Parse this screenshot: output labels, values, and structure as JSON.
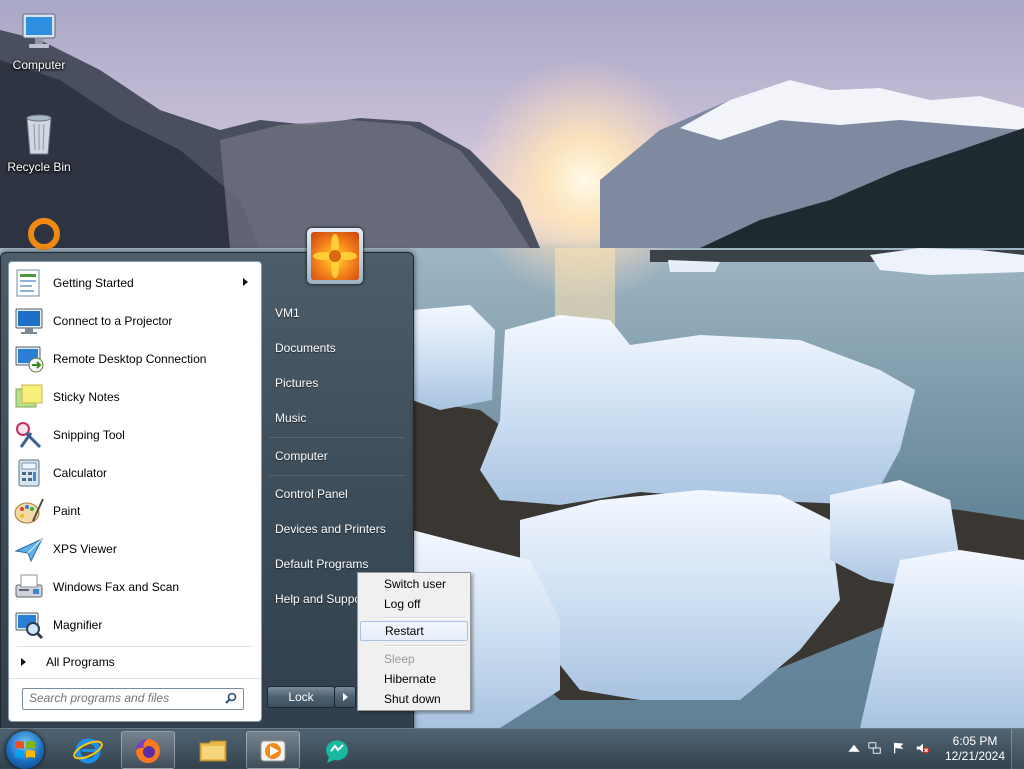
{
  "desktop": {
    "icons": [
      {
        "label": "Computer",
        "icon": "computer-icon"
      },
      {
        "label": "Recycle Bin",
        "icon": "recycle-bin-icon"
      }
    ]
  },
  "start_menu": {
    "programs": [
      {
        "label": "Getting Started",
        "icon": "getting-started-icon",
        "has_submenu": true
      },
      {
        "label": "Connect to a Projector",
        "icon": "projector-icon"
      },
      {
        "label": "Remote Desktop Connection",
        "icon": "remote-desktop-icon"
      },
      {
        "label": "Sticky Notes",
        "icon": "sticky-notes-icon"
      },
      {
        "label": "Snipping Tool",
        "icon": "scissors-icon"
      },
      {
        "label": "Calculator",
        "icon": "calculator-icon"
      },
      {
        "label": "Paint",
        "icon": "paint-palette-icon"
      },
      {
        "label": "XPS Viewer",
        "icon": "xps-viewer-icon"
      },
      {
        "label": "Windows Fax and Scan",
        "icon": "fax-icon"
      },
      {
        "label": "Magnifier",
        "icon": "magnifier-icon"
      }
    ],
    "all_programs": "All Programs",
    "search_placeholder": "Search programs and files",
    "right_items": [
      "VM1",
      "Documents",
      "Pictures",
      "Music",
      "Computer",
      "Control Panel",
      "Devices and Printers",
      "Default Programs",
      "Help and Support"
    ],
    "shutdown_button": "Lock"
  },
  "power_menu": {
    "items": [
      {
        "label": "Switch user",
        "enabled": true
      },
      {
        "label": "Log off",
        "enabled": true
      },
      {
        "label": "Restart",
        "enabled": true,
        "highlighted": true
      },
      {
        "label": "Sleep",
        "enabled": false
      },
      {
        "label": "Hibernate",
        "enabled": true
      },
      {
        "label": "Shut down",
        "enabled": true
      }
    ]
  },
  "taskbar": {
    "pinned": [
      "internet-explorer-icon",
      "firefox-icon",
      "file-explorer-icon",
      "media-player-icon",
      "messenger-icon"
    ],
    "clock": {
      "time": "6:05 PM",
      "date": "12/21/2024"
    }
  },
  "colors": {
    "accent": "#1a6fc0",
    "menu_bg": "#465662",
    "highlight": "#e5eefa"
  }
}
